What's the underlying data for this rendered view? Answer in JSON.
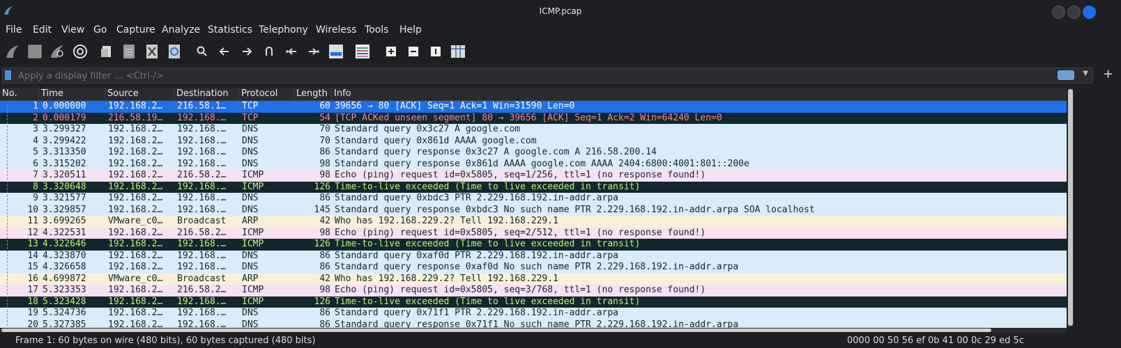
{
  "window": {
    "title": "ICMP.pcap"
  },
  "menu": [
    {
      "label": "File"
    },
    {
      "label": "Edit"
    },
    {
      "label": "View"
    },
    {
      "label": "Go"
    },
    {
      "label": "Capture"
    },
    {
      "label": "Analyze"
    },
    {
      "label": "Statistics"
    },
    {
      "label": "Telephony"
    },
    {
      "label": "Wireless"
    },
    {
      "label": "Tools"
    },
    {
      "label": "Help"
    }
  ],
  "toolbar_icons": [
    "shark-fin-start-icon",
    "stop-square-icon",
    "restart-fin-icon",
    "options-gear-icon",
    "open-file-icon",
    "save-file-icon",
    "close-file-icon",
    "reload-icon",
    "search-icon",
    "back-arrow-icon",
    "forward-arrow-icon",
    "go-to-packet-icon",
    "first-packet-icon",
    "last-packet-icon",
    "autoscroll-icon",
    "colorize-icon",
    "zoom-in-icon",
    "zoom-out-icon",
    "normal-size-icon",
    "resize-columns-icon"
  ],
  "filter": {
    "placeholder": "Apply a display filter … <Ctrl-/>",
    "value": ""
  },
  "columns": {
    "no": "No.",
    "time": "Time",
    "source": "Source",
    "destination": "Destination",
    "protocol": "Protocol",
    "length": "Length",
    "info": "Info"
  },
  "colors": {
    "selected_bg": "#1e6fe8",
    "dns_bg": "#d9ecfc",
    "icmp_bg": "#fae0f5",
    "ttl_bg": "#12272e",
    "ttl_fg": "#b7f775",
    "arp_bg": "#faf0d8",
    "tcp_bad_bg": "#12272e",
    "tcp_bad_fg": "#f78787"
  },
  "packets": [
    {
      "no": "1",
      "time": "0.000000",
      "src": "192.168.2…",
      "dst": "216.58.1…",
      "proto": "TCP",
      "len": "60",
      "info": "39656 → 80 [ACK] Seq=1 Ack=1 Win=31590 Len=0",
      "bg": "#1e6fe8",
      "fg": "#ffffff"
    },
    {
      "no": "2",
      "time": "0.000179",
      "src": "216.58.19…",
      "dst": "192.168.…",
      "proto": "TCP",
      "len": "54",
      "info": "[TCP ACKed unseen segment] 80 → 39656 [ACK] Seq=1 Ack=2 Win=64240 Len=0",
      "bg": "#12272e",
      "fg": "#f78787"
    },
    {
      "no": "3",
      "time": "3.299327",
      "src": "192.168.2…",
      "dst": "192.168.…",
      "proto": "DNS",
      "len": "70",
      "info": "Standard query 0x3c27 A google.com",
      "bg": "#d9ecfc",
      "fg": "#12272e"
    },
    {
      "no": "4",
      "time": "3.299422",
      "src": "192.168.2…",
      "dst": "192.168.…",
      "proto": "DNS",
      "len": "70",
      "info": "Standard query 0x861d AAAA google.com",
      "bg": "#d9ecfc",
      "fg": "#12272e"
    },
    {
      "no": "5",
      "time": "3.313350",
      "src": "192.168.2…",
      "dst": "192.168.…",
      "proto": "DNS",
      "len": "86",
      "info": "Standard query response 0x3c27 A google.com A 216.58.200.14",
      "bg": "#d9ecfc",
      "fg": "#12272e"
    },
    {
      "no": "6",
      "time": "3.315202",
      "src": "192.168.2…",
      "dst": "192.168.…",
      "proto": "DNS",
      "len": "98",
      "info": "Standard query response 0x861d AAAA google.com AAAA 2404:6800:4001:801::200e",
      "bg": "#d9ecfc",
      "fg": "#12272e"
    },
    {
      "no": "7",
      "time": "3.320511",
      "src": "192.168.2…",
      "dst": "216.58.2…",
      "proto": "ICMP",
      "len": "98",
      "info": "Echo (ping) request  id=0x5805, seq=1/256, ttl=1 (no response found!)",
      "bg": "#fae0f5",
      "fg": "#12272e"
    },
    {
      "no": "8",
      "time": "3.320648",
      "src": "192.168.2…",
      "dst": "192.168.…",
      "proto": "ICMP",
      "len": "126",
      "info": "Time-to-live exceeded (Time to live exceeded in transit)",
      "bg": "#12272e",
      "fg": "#b7f775"
    },
    {
      "no": "9",
      "time": "3.321577",
      "src": "192.168.2…",
      "dst": "192.168.…",
      "proto": "DNS",
      "len": "86",
      "info": "Standard query 0xbdc3 PTR 2.229.168.192.in-addr.arpa",
      "bg": "#d9ecfc",
      "fg": "#12272e"
    },
    {
      "no": "10",
      "time": "3.329857",
      "src": "192.168.2…",
      "dst": "192.168.…",
      "proto": "DNS",
      "len": "145",
      "info": "Standard query response 0xbdc3 No such name PTR 2.229.168.192.in-addr.arpa SOA localhost",
      "bg": "#d9ecfc",
      "fg": "#12272e"
    },
    {
      "no": "11",
      "time": "3.699265",
      "src": "VMware_c0…",
      "dst": "Broadcast",
      "proto": "ARP",
      "len": "42",
      "info": "Who has 192.168.229.2? Tell 192.168.229.1",
      "bg": "#faf0d8",
      "fg": "#12272e"
    },
    {
      "no": "12",
      "time": "4.322531",
      "src": "192.168.2…",
      "dst": "216.58.2…",
      "proto": "ICMP",
      "len": "98",
      "info": "Echo (ping) request  id=0x5805, seq=2/512, ttl=1 (no response found!)",
      "bg": "#fae0f5",
      "fg": "#12272e"
    },
    {
      "no": "13",
      "time": "4.322646",
      "src": "192.168.2…",
      "dst": "192.168.…",
      "proto": "ICMP",
      "len": "126",
      "info": "Time-to-live exceeded (Time to live exceeded in transit)",
      "bg": "#12272e",
      "fg": "#b7f775"
    },
    {
      "no": "14",
      "time": "4.323870",
      "src": "192.168.2…",
      "dst": "192.168.…",
      "proto": "DNS",
      "len": "86",
      "info": "Standard query 0xaf0d PTR 2.229.168.192.in-addr.arpa",
      "bg": "#d9ecfc",
      "fg": "#12272e"
    },
    {
      "no": "15",
      "time": "4.326658",
      "src": "192.168.2…",
      "dst": "192.168.…",
      "proto": "DNS",
      "len": "86",
      "info": "Standard query response 0xaf0d No such name PTR 2.229.168.192.in-addr.arpa",
      "bg": "#d9ecfc",
      "fg": "#12272e"
    },
    {
      "no": "16",
      "time": "4.699872",
      "src": "VMware_c0…",
      "dst": "Broadcast",
      "proto": "ARP",
      "len": "42",
      "info": "Who has 192.168.229.2? Tell 192.168.229.1",
      "bg": "#faf0d8",
      "fg": "#12272e"
    },
    {
      "no": "17",
      "time": "5.323353",
      "src": "192.168.2…",
      "dst": "216.58.2…",
      "proto": "ICMP",
      "len": "98",
      "info": "Echo (ping) request  id=0x5805, seq=3/768, ttl=1 (no response found!)",
      "bg": "#fae0f5",
      "fg": "#12272e"
    },
    {
      "no": "18",
      "time": "5.323428",
      "src": "192.168.2…",
      "dst": "192.168.…",
      "proto": "ICMP",
      "len": "126",
      "info": "Time-to-live exceeded (Time to live exceeded in transit)",
      "bg": "#12272e",
      "fg": "#b7f775"
    },
    {
      "no": "19",
      "time": "5.324736",
      "src": "192.168.2…",
      "dst": "192.168.…",
      "proto": "DNS",
      "len": "86",
      "info": "Standard query 0x71f1 PTR 2.229.168.192.in-addr.arpa",
      "bg": "#d9ecfc",
      "fg": "#12272e"
    },
    {
      "no": "20",
      "time": "5.327385",
      "src": "192.168.2…",
      "dst": "192.168.…",
      "proto": "DNS",
      "len": "86",
      "info": "Standard query response 0x71f1 No such name PTR 2.229.168.192.in-addr.arpa",
      "bg": "#d9ecfc",
      "fg": "#12272e"
    }
  ],
  "status": {
    "left": "Frame 1: 60 bytes on wire (480 bits), 60 bytes captured (480 bits)",
    "right": "0000  00 50 56 ef 0b 41 00 0c  29 ed 5c"
  }
}
